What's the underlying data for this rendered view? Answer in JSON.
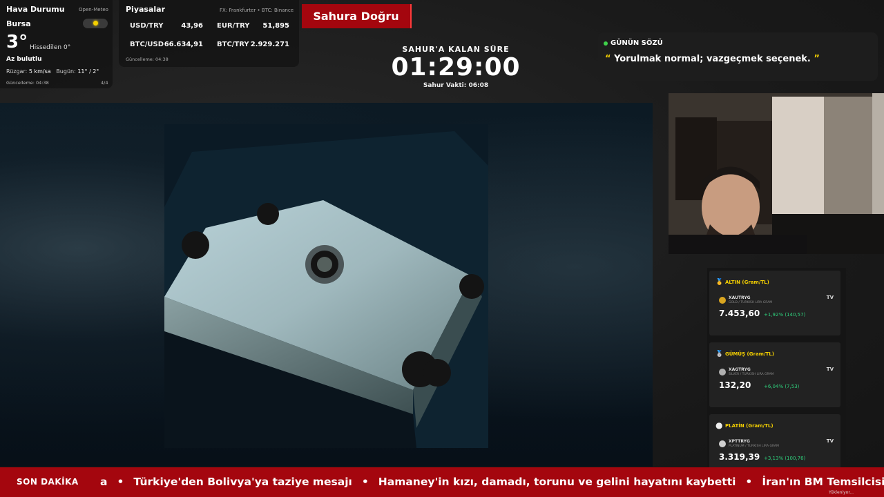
{
  "weather": {
    "title": "Hava Durumu",
    "source": "Open-Meteo",
    "city": "Bursa",
    "temperature": "3°",
    "feels_like": "Hissedilen 0°",
    "condition": "Az bulutlu",
    "wind_label": "Rüzgar:",
    "wind_value": "5 km/sa",
    "today_label": "Bugün:",
    "today_value": "11° / 2°",
    "updated": "Güncelleme: 04:38",
    "page": "4/4",
    "icon": "sun-icon"
  },
  "markets": {
    "title": "Piyasalar",
    "source": "FX: Frankfurter • BTC: Binance",
    "rows": [
      {
        "pair": "USD/TRY",
        "value": "43,96",
        "pair2": "EUR/TRY",
        "value2": "51,895"
      },
      {
        "pair": "BTC/USD",
        "value": "66.634,91",
        "pair2": "BTC/TRY",
        "value2": "2.929.271"
      }
    ],
    "updated": "Güncelleme: 04:38"
  },
  "banner": {
    "title": "Sahura Doğru"
  },
  "countdown": {
    "label": "SAHUR'A KALAN SÜRE",
    "time": "01:29:00",
    "sahur_time": "Sahur Vakti: 06:08"
  },
  "quote": {
    "label": "GÜNÜN SÖZÜ",
    "open_quote": "“",
    "text": "Yorulmak normal; vazgeçmek seçenek.",
    "close_quote": "”"
  },
  "metals": [
    {
      "header": "ALTIN (Gram/TL)",
      "symbol": "XAUTRYG",
      "sub": "GOLD / TURKISH LIRA GRAM",
      "price": "7.453,60",
      "change": "+1,92% (140,57)",
      "coin_color": "#d9a520",
      "icon": "medal-gold-icon"
    },
    {
      "header": "GÜMÜŞ (Gram/TL)",
      "symbol": "XAGTRYG",
      "sub": "SILVER / TURKISH LIRA GRAM",
      "price": "132,20",
      "change": "+6,04% (7,53)",
      "coin_color": "#b0b0b0",
      "icon": "medal-silver-icon"
    },
    {
      "header": "PLATİN (Gram/TL)",
      "symbol": "XPTTRYG",
      "sub": "PLATINUM / TURKISH LIRA GRAM",
      "price": "3.319,39",
      "change": "+3,13% (100,76)",
      "coin_color": "#cfcfcf",
      "icon": "platinum-circle-icon"
    }
  ],
  "tv_badge": "TV",
  "ticker": {
    "label": "SON DAKİKA",
    "items": [
      "a",
      "Türkiye'den Bolivya'ya taziye mesajı",
      "Hamaney'in kızı, damadı, torunu ve gelini hayatını kaybetti",
      "İran'ın BM Temsilcisi: A"
    ],
    "separator": "•",
    "loading": "Yükleniyor..."
  }
}
